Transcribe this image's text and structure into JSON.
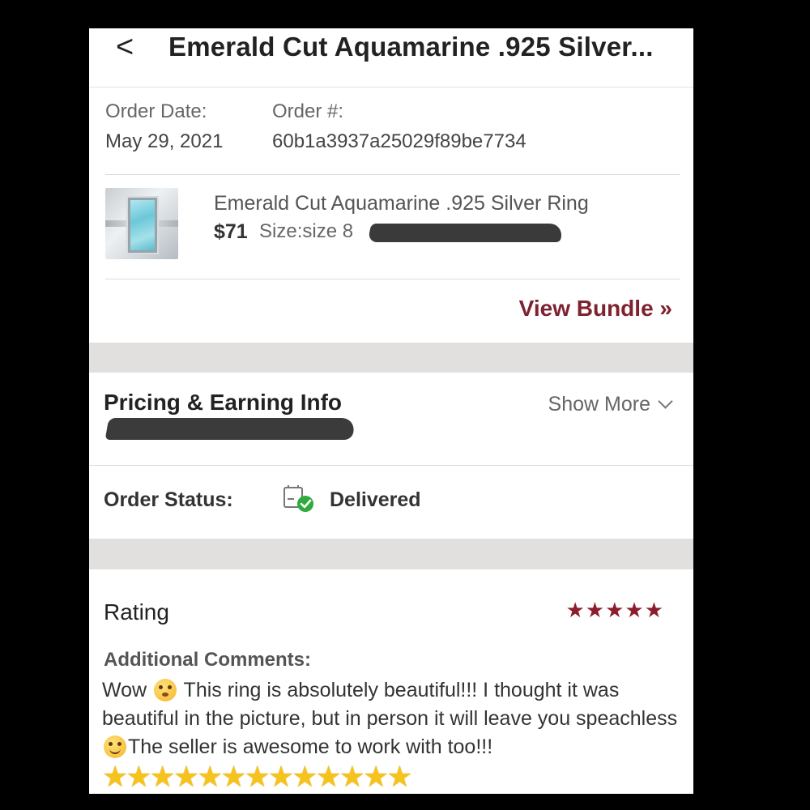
{
  "header": {
    "back_icon": "chevron-left-icon",
    "back_glyph": "<",
    "title": "Emerald Cut Aquamarine .925 Silver..."
  },
  "order": {
    "date_label": "Order Date:",
    "date_value": "May 29, 2021",
    "number_label": "Order #:",
    "number_value": "60b1a3937a25029f89be7734"
  },
  "product": {
    "name": "Emerald Cut Aquamarine .925 Silver Ring",
    "price": "$71",
    "size": "Size:size 8"
  },
  "view_bundle_label": "View Bundle »",
  "pricing": {
    "title": "Pricing & Earning Info",
    "show_more_label": "Show More"
  },
  "status": {
    "label": "Order Status:",
    "value": "Delivered",
    "icon": "delivered-package-icon"
  },
  "rating": {
    "label": "Rating",
    "stars": "★★★★★",
    "value": 5,
    "max": 5,
    "color": "#8b1e2c"
  },
  "comments": {
    "label": "Additional Comments:",
    "part1": "Wow ",
    "part2": " This ring is absolutely beautiful!!! I thought it was beautiful in the picture, but in person it will leave you speachless ",
    "part3": "The seller is awesome to work with too!!!",
    "gold_stars": "★★★★★★★★★★★★★"
  },
  "colors": {
    "accent": "#7f2230",
    "band": "#e2e0de",
    "success": "#2faa3d"
  }
}
